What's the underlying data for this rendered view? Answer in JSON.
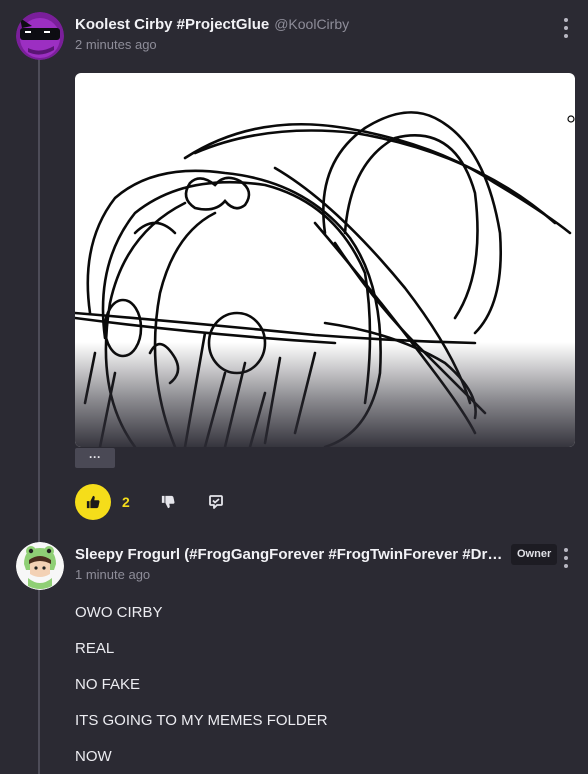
{
  "post1": {
    "username": "Koolest Cirby #ProjectGlue",
    "handle": "@KoolCirby",
    "time": "2 minutes ago",
    "more_label": "···",
    "like_count": "2",
    "colors": {
      "like": "#f5dd1a"
    },
    "icons": [
      "thumbs-up-icon",
      "thumbs-down-icon",
      "reply-icon",
      "kebab-menu-icon"
    ]
  },
  "post2": {
    "username": "Sleepy Frogurl (#FrogGangForever #FrogTwinForever #DrummerBoy",
    "time": "1 minute ago",
    "badge": "Owner",
    "lines": [
      "OWO CIRBY",
      "REAL",
      "NO FAKE",
      "ITS GOING TO MY MEMES FOLDER",
      "NOW"
    ]
  }
}
